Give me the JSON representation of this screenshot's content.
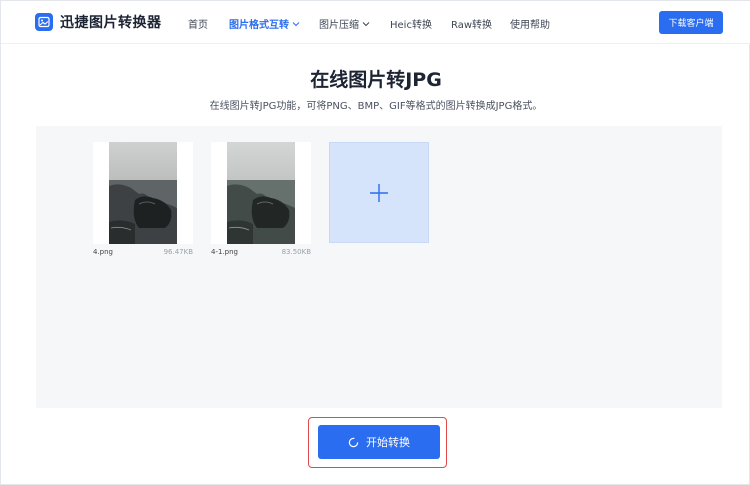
{
  "header": {
    "app_name": "迅捷图片转换器",
    "nav": [
      {
        "label": "首页"
      },
      {
        "label": "图片格式互转"
      },
      {
        "label": "图片压缩"
      },
      {
        "label": "Heic转换"
      },
      {
        "label": "Raw转换"
      },
      {
        "label": "使用帮助"
      }
    ],
    "download_label": "下载客户端"
  },
  "main": {
    "title": "在线图片转JPG",
    "subtitle": "在线图片转JPG功能，可将PNG、BMP、GIF等格式的图片转换成JPG格式。"
  },
  "files": [
    {
      "name": "4.png",
      "size": "96.47KB"
    },
    {
      "name": "4-1.png",
      "size": "83.50KB"
    }
  ],
  "actions": {
    "convert_label": "开始转换"
  },
  "colors": {
    "accent": "#2b6df0",
    "highlight": "#e04a4a",
    "add_box": "#d6e4fb"
  }
}
